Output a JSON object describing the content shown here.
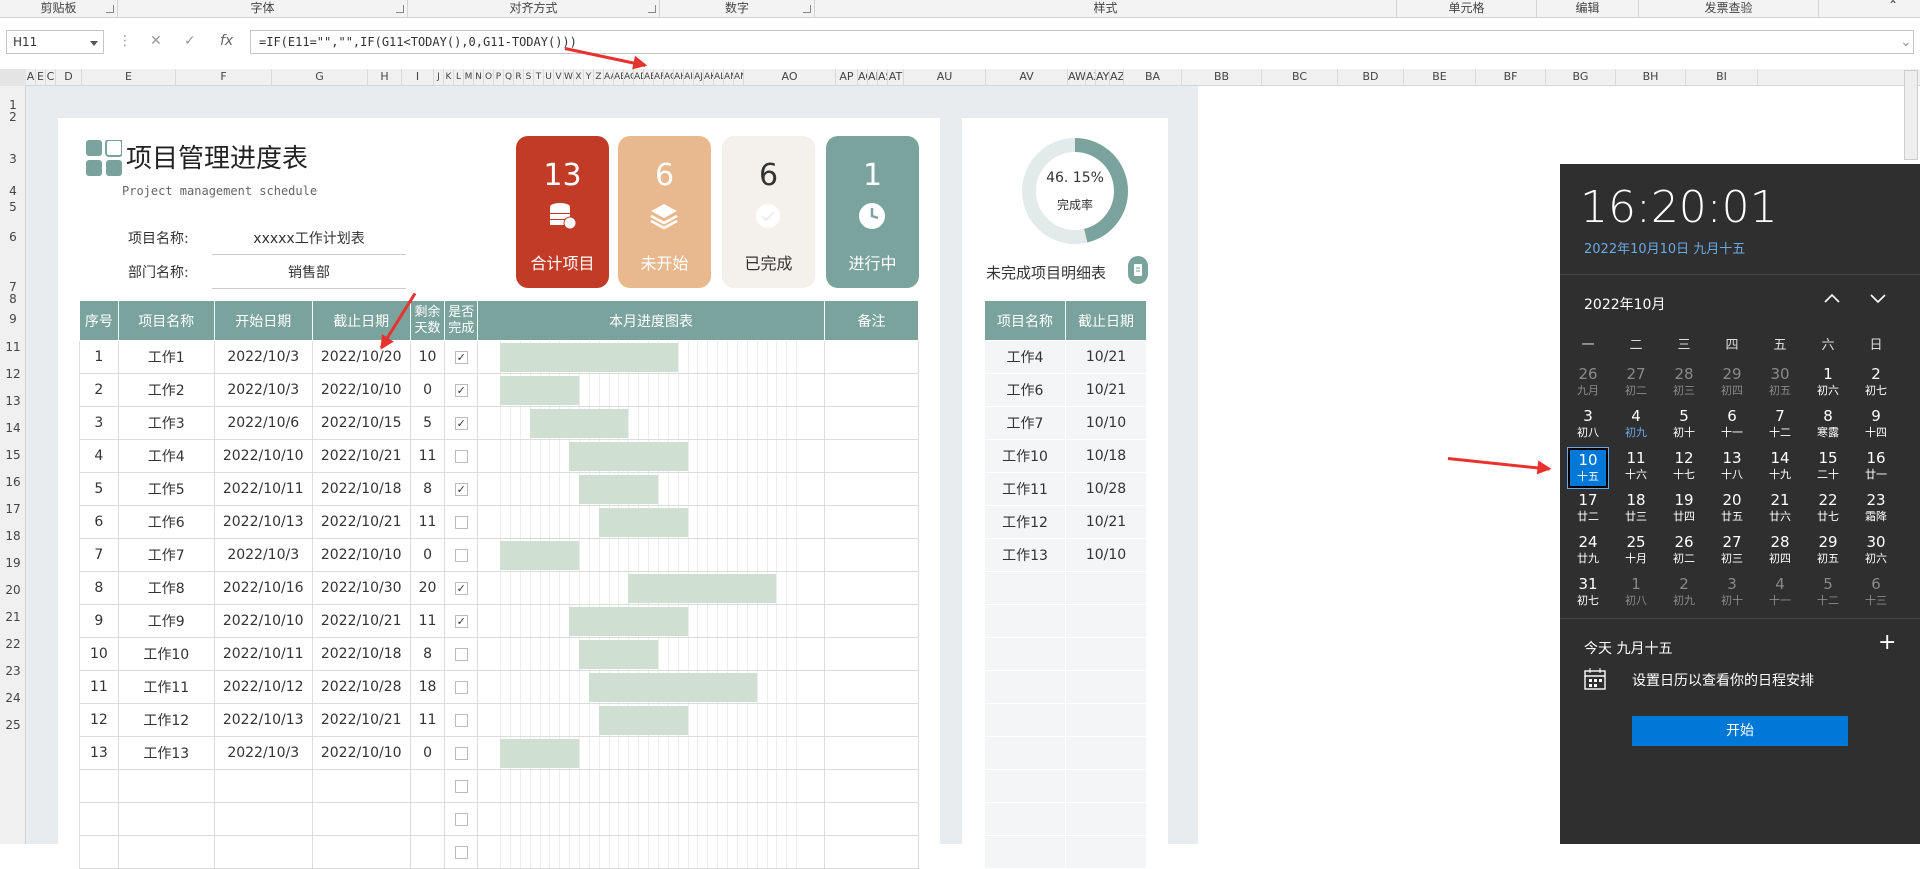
{
  "ribbon": {
    "groups": [
      "剪贴板",
      "字体",
      "对齐方式",
      "数字",
      "样式",
      "单元格",
      "编辑",
      "发票查验"
    ]
  },
  "formula_bar": {
    "name_box": "H11",
    "formula": "=IF(E11=\"\",\"\",IF(G11<TODAY(),0,G11-TODAY()))"
  },
  "columns": [
    "A",
    "E",
    "C",
    "D",
    "E",
    "F",
    "G",
    "H",
    "I",
    "J",
    "K",
    "L",
    "M",
    "N",
    "O",
    "P",
    "Q",
    "R",
    "S",
    "T",
    "U",
    "V",
    "W",
    "X",
    "Y",
    "Z",
    "AA",
    "AB",
    "AC",
    "AD",
    "AE",
    "AF",
    "AG",
    "AH",
    "AI",
    "AJ",
    "AK",
    "AL",
    "AM",
    "AN",
    "AO",
    "AP",
    "AQ",
    "AR",
    "AS",
    "AT",
    "AU",
    "AV",
    "AW",
    "AX",
    "AY",
    "AZ",
    "BA",
    "BB",
    "BC",
    "BD",
    "BE",
    "BF",
    "BG",
    "BH",
    "BI"
  ],
  "col_labels_wide": {
    "D": "D",
    "E": "E",
    "F": "F",
    "G": "G",
    "H": "H",
    "I": "I",
    "AO": "AO",
    "AP": "AP",
    "AQ": "AQ",
    "AR": "AR",
    "AS": "AS",
    "AT": "AT",
    "AU": "AU",
    "AV": "AV",
    "AW": "AW",
    "AX": "AX",
    "AY": "AY",
    "AZ": "AZ",
    "BA": "BA",
    "BB": "BB",
    "BC": "BC",
    "BD": "BD",
    "BE": "BE",
    "BF": "BF",
    "BG": "BG",
    "BH": "BH",
    "BI": "BI"
  },
  "rows": [
    "1",
    "2",
    "3",
    "4",
    "5",
    "6",
    "7",
    "8",
    "9",
    "11",
    "12",
    "13",
    "14",
    "15",
    "16",
    "17",
    "18",
    "19",
    "20",
    "21",
    "22",
    "23",
    "24",
    "25"
  ],
  "header": {
    "title": "项目管理进度表",
    "subtitle": "Project management schedule",
    "project_label": "项目名称:",
    "project_value": "xxxxx工作计划表",
    "dept_label": "部门名称:",
    "dept_value": "销售部"
  },
  "cards": [
    {
      "num": "13",
      "label": "合计项目",
      "color": "#c23b26",
      "icon": "database-icon"
    },
    {
      "num": "6",
      "label": "未开始",
      "color": "#e8b98e",
      "icon": "layers-icon"
    },
    {
      "num": "6",
      "label": "已完成",
      "color": "#f4f0eb",
      "icon": "check-icon"
    },
    {
      "num": "1",
      "label": "进行中",
      "color": "#7aa39d",
      "icon": "clock-icon"
    }
  ],
  "table": {
    "headers": [
      "序号",
      "项目名称",
      "开始日期",
      "截止日期",
      "剩余天数",
      "是否完成",
      "本月进度图表",
      "备注"
    ],
    "rows": [
      {
        "no": "1",
        "name": "工作1",
        "start": "2022/10/3",
        "end": "2022/10/20",
        "left": "10",
        "done": true,
        "s": 3,
        "e": 20
      },
      {
        "no": "2",
        "name": "工作2",
        "start": "2022/10/3",
        "end": "2022/10/10",
        "left": "0",
        "done": true,
        "s": 3,
        "e": 10
      },
      {
        "no": "3",
        "name": "工作3",
        "start": "2022/10/6",
        "end": "2022/10/15",
        "left": "5",
        "done": true,
        "s": 6,
        "e": 15
      },
      {
        "no": "4",
        "name": "工作4",
        "start": "2022/10/10",
        "end": "2022/10/21",
        "left": "11",
        "done": false,
        "s": 10,
        "e": 21
      },
      {
        "no": "5",
        "name": "工作5",
        "start": "2022/10/11",
        "end": "2022/10/18",
        "left": "8",
        "done": true,
        "s": 11,
        "e": 18
      },
      {
        "no": "6",
        "name": "工作6",
        "start": "2022/10/13",
        "end": "2022/10/21",
        "left": "11",
        "done": false,
        "s": 13,
        "e": 21
      },
      {
        "no": "7",
        "name": "工作7",
        "start": "2022/10/3",
        "end": "2022/10/10",
        "left": "0",
        "done": false,
        "s": 3,
        "e": 10
      },
      {
        "no": "8",
        "name": "工作8",
        "start": "2022/10/16",
        "end": "2022/10/30",
        "left": "20",
        "done": true,
        "s": 16,
        "e": 30
      },
      {
        "no": "9",
        "name": "工作9",
        "start": "2022/10/10",
        "end": "2022/10/21",
        "left": "11",
        "done": true,
        "s": 10,
        "e": 21
      },
      {
        "no": "10",
        "name": "工作10",
        "start": "2022/10/11",
        "end": "2022/10/18",
        "left": "8",
        "done": false,
        "s": 11,
        "e": 18
      },
      {
        "no": "11",
        "name": "工作11",
        "start": "2022/10/12",
        "end": "2022/10/28",
        "left": "18",
        "done": false,
        "s": 12,
        "e": 28
      },
      {
        "no": "12",
        "name": "工作12",
        "start": "2022/10/13",
        "end": "2022/10/21",
        "left": "11",
        "done": false,
        "s": 13,
        "e": 21
      },
      {
        "no": "13",
        "name": "工作13",
        "start": "2022/10/3",
        "end": "2022/10/10",
        "left": "0",
        "done": false,
        "s": 3,
        "e": 10
      }
    ]
  },
  "donut": {
    "percent": "46. 15%",
    "label": "完成率",
    "ratio": 0.4615
  },
  "side": {
    "title": "未完成项目明细表",
    "headers": [
      "项目名称",
      "截止日期"
    ],
    "rows": [
      [
        "工作4",
        "10/21"
      ],
      [
        "工作6",
        "10/21"
      ],
      [
        "工作7",
        "10/10"
      ],
      [
        "工作10",
        "10/18"
      ],
      [
        "工作11",
        "10/28"
      ],
      [
        "工作12",
        "10/21"
      ],
      [
        "工作13",
        "10/10"
      ]
    ]
  },
  "calendar": {
    "time": "16:20:01",
    "date": "2022年10月10日 九月十五",
    "month": "2022年10月",
    "weekdays": [
      "一",
      "二",
      "三",
      "四",
      "五",
      "六",
      "日"
    ],
    "days": [
      [
        "26",
        "九月",
        1
      ],
      [
        "27",
        "初二",
        1
      ],
      [
        "28",
        "初三",
        1
      ],
      [
        "29",
        "初四",
        1
      ],
      [
        "30",
        "初五",
        1
      ],
      [
        "1",
        "初六",
        0
      ],
      [
        "2",
        "初七",
        0
      ],
      [
        "3",
        "初八",
        0
      ],
      [
        "4",
        "初九",
        0
      ],
      [
        "5",
        "初十",
        0
      ],
      [
        "6",
        "十一",
        0
      ],
      [
        "7",
        "十二",
        0
      ],
      [
        "8",
        "寒露",
        0
      ],
      [
        "9",
        "十四",
        0
      ],
      [
        "10",
        "十五",
        2
      ],
      [
        "11",
        "十六",
        0
      ],
      [
        "12",
        "十七",
        0
      ],
      [
        "13",
        "十八",
        0
      ],
      [
        "14",
        "十九",
        0
      ],
      [
        "15",
        "二十",
        0
      ],
      [
        "16",
        "廿一",
        0
      ],
      [
        "17",
        "廿二",
        0
      ],
      [
        "18",
        "廿三",
        0
      ],
      [
        "19",
        "廿四",
        0
      ],
      [
        "20",
        "廿五",
        0
      ],
      [
        "21",
        "廿六",
        0
      ],
      [
        "22",
        "廿七",
        0
      ],
      [
        "23",
        "霜降",
        0
      ],
      [
        "24",
        "廿九",
        0
      ],
      [
        "25",
        "十月",
        0
      ],
      [
        "26",
        "初二",
        0
      ],
      [
        "27",
        "初三",
        0
      ],
      [
        "28",
        "初四",
        0
      ],
      [
        "29",
        "初五",
        0
      ],
      [
        "30",
        "初六",
        0
      ],
      [
        "31",
        "初七",
        0
      ],
      [
        "1",
        "初八",
        1
      ],
      [
        "2",
        "初九",
        1
      ],
      [
        "3",
        "初十",
        1
      ],
      [
        "4",
        "十一",
        1
      ],
      [
        "5",
        "十二",
        1
      ],
      [
        "6",
        "十三",
        1
      ]
    ],
    "today_label": "今天 九月十五",
    "plus": "+",
    "agenda": "设置日历以查看你的日程安排",
    "start_button": "开始"
  },
  "colors": {
    "accent": "#7aa39d",
    "bar": "#cfdfd2",
    "red": "#e8322e",
    "blue": "#0078d7"
  }
}
